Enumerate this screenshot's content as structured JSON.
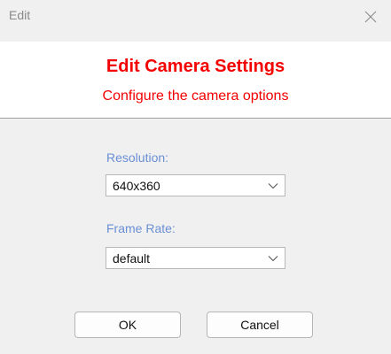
{
  "window": {
    "title": "Edit",
    "close_icon": "close-icon"
  },
  "header": {
    "title": "Edit Camera Settings",
    "subtitle": "Configure the camera options",
    "accent_color": "#f40000"
  },
  "form": {
    "resolution": {
      "label": "Resolution:",
      "value": "640x360",
      "icon": "chevron-down-icon"
    },
    "frame_rate": {
      "label": "Frame Rate:",
      "value": "default",
      "icon": "chevron-down-icon"
    },
    "label_color": "#6a8fd6"
  },
  "buttons": {
    "ok_label": "OK",
    "cancel_label": "Cancel"
  }
}
